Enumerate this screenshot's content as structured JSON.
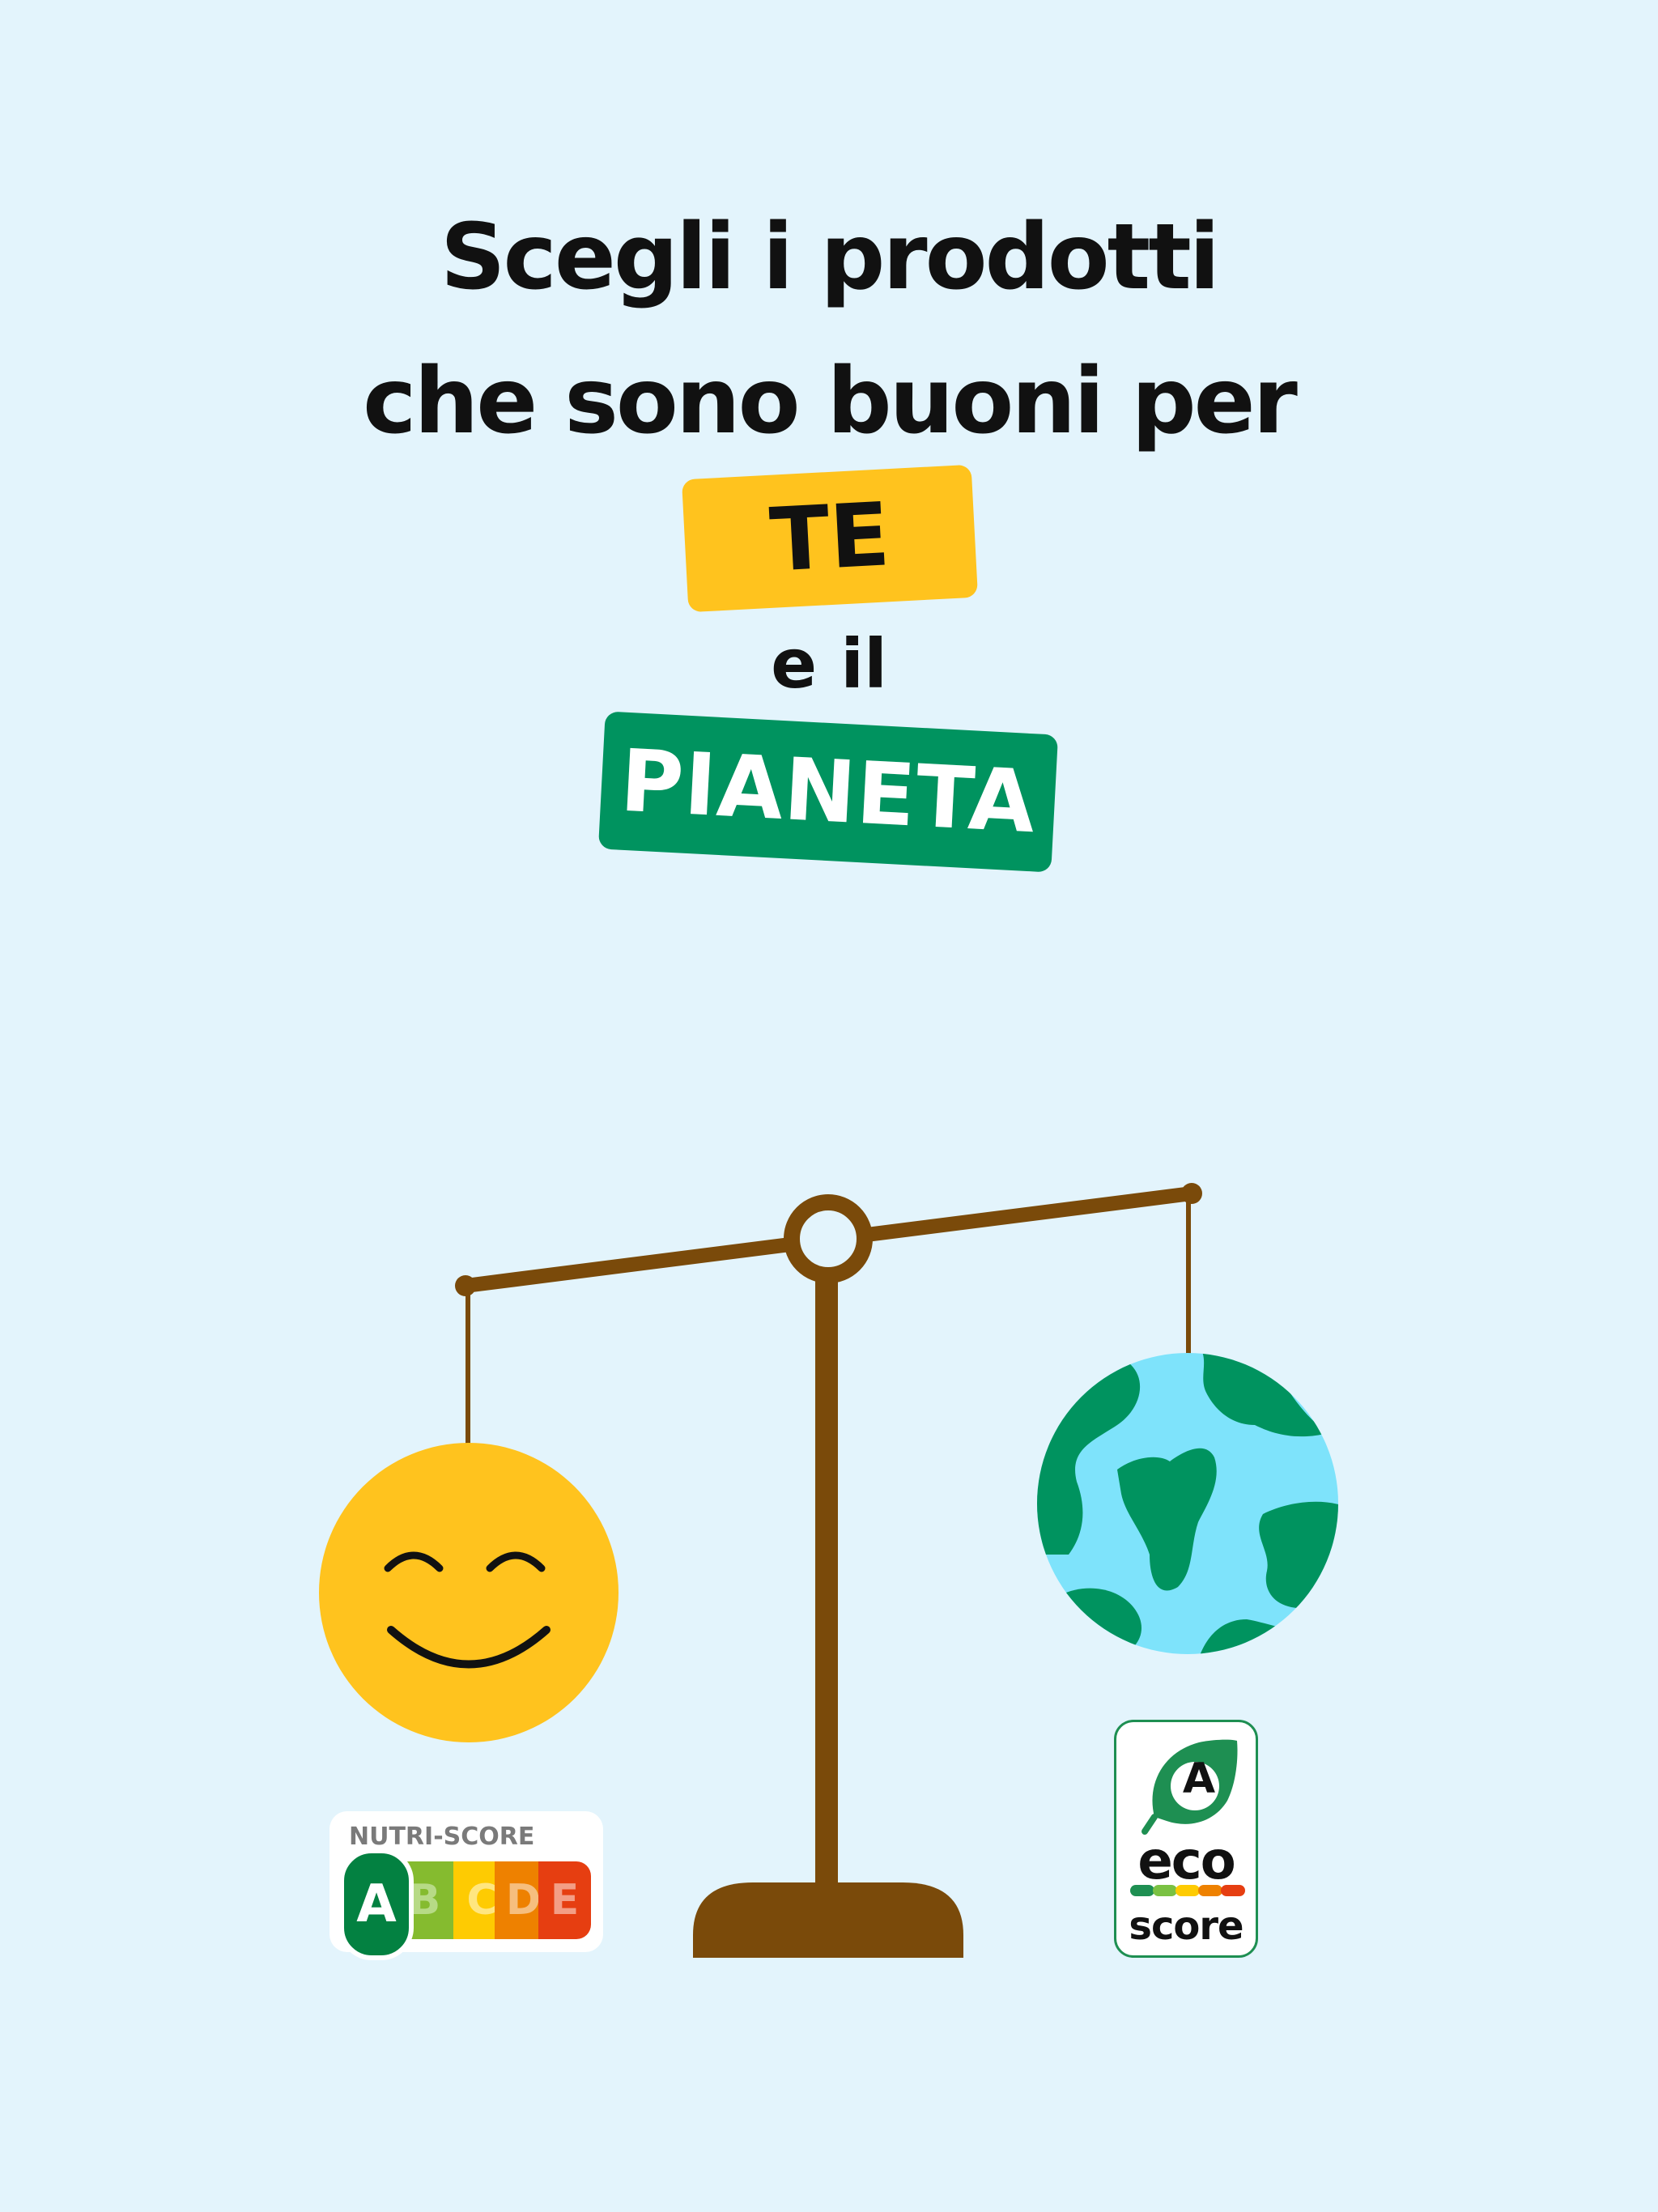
{
  "headline": {
    "line1": "Scegli i prodotti",
    "line2": "che sono buoni per",
    "highlight_you": "TE",
    "conjunction": "e il",
    "highlight_planet": "PIANETA"
  },
  "nutri_score": {
    "title": "NUTRI-SCORE",
    "grades": [
      "A",
      "B",
      "C",
      "D",
      "E"
    ],
    "selected": "A"
  },
  "eco_score": {
    "grade": "A",
    "word1": "eco",
    "word2": "score"
  },
  "colors": {
    "background": "#E3F4FC",
    "you_highlight": "#FFC31E",
    "planet_highlight": "#00935F",
    "scale": "#7A4A0A",
    "smiley": "#FFC31E",
    "ocean": "#7EE3FB",
    "land": "#00935F"
  },
  "icons": [
    "balance-scale-icon",
    "smiley-face-icon",
    "earth-globe-icon",
    "leaf-icon"
  ]
}
